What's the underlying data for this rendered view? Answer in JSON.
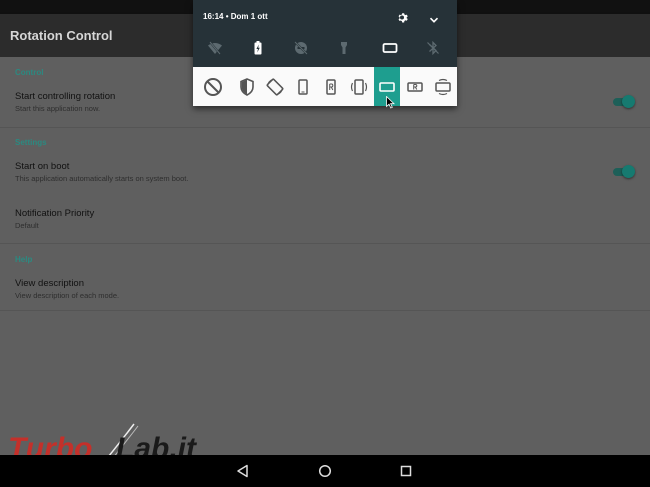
{
  "app": {
    "title": "Rotation Control"
  },
  "sections": {
    "control": "Control",
    "settings": "Settings",
    "help": "Help"
  },
  "prefs": {
    "start_controlling": {
      "title": "Start controlling rotation",
      "summary": "Start this application now.",
      "enabled": true
    },
    "start_on_boot": {
      "title": "Start on boot",
      "summary": "This application automatically starts on system boot.",
      "enabled": true
    },
    "notification_priority": {
      "title": "Notification Priority",
      "summary": "Default"
    },
    "view_description": {
      "title": "View description",
      "summary": "View description of each mode."
    }
  },
  "shade": {
    "time": "16:14",
    "date": "Dom 1 ott",
    "quick_settings": [
      "wifi-off-icon",
      "battery-charging-icon",
      "do-not-disturb-icon",
      "flashlight-icon",
      "landscape-orientation-icon",
      "bluetooth-off-icon"
    ],
    "modes": [
      "no-control",
      "forced-auto",
      "auto-rotate",
      "portrait",
      "reverse-portrait",
      "sensor-portrait",
      "landscape",
      "reverse-landscape",
      "sensor-landscape"
    ],
    "selected_mode": "landscape"
  },
  "navigation": [
    "back",
    "home",
    "recents"
  ],
  "watermark": {
    "text_left": "Turbo",
    "text_right": "Lab.it"
  },
  "colors": {
    "accent": "#1e9e8f",
    "shade_bg": "#263238",
    "section_header": "#2b8a81"
  }
}
